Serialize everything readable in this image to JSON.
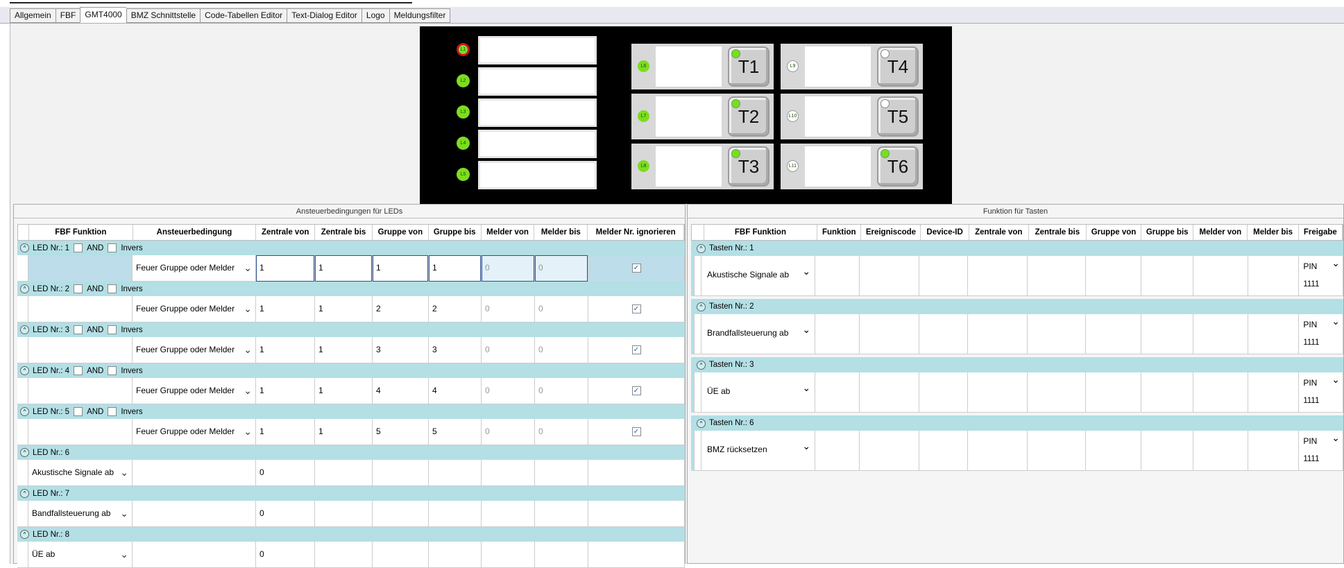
{
  "tabs": [
    "Allgemein",
    "FBF",
    "GMT4000",
    "BMZ Schnittstelle",
    "Code-Tabellen Editor",
    "Text-Dialog Editor",
    "Logo",
    "Meldungsfilter"
  ],
  "active_tab": "GMT4000",
  "panel": {
    "leds_left": [
      "L1",
      "L2",
      "L3",
      "L4",
      "L5"
    ],
    "led_mid": [
      "L6",
      "L7",
      "L8"
    ],
    "led_right": [
      "L9",
      "L10",
      "L11"
    ],
    "keys_mid": [
      "T1",
      "T2",
      "T3"
    ],
    "keys_right": [
      "T4",
      "T5",
      "T6"
    ]
  },
  "left": {
    "title": "Ansteuerbedingungen für LEDs",
    "headers": [
      "FBF Funktion",
      "Ansteuerbedingung",
      "Zentrale von",
      "Zentrale bis",
      "Gruppe von",
      "Gruppe bis",
      "Melder von",
      "Melder bis",
      "Melder Nr. ignorieren"
    ],
    "and_label": "AND",
    "invers_label": "Invers",
    "groups": [
      {
        "label": "LED Nr.: 1",
        "fbf": "",
        "bed": "Feuer Gruppe oder Melder",
        "zv": "1",
        "zb": "1",
        "gv": "1",
        "gb": "1",
        "mv": "0",
        "mb": "0"
      },
      {
        "label": "LED Nr.: 2",
        "fbf": "",
        "bed": "Feuer Gruppe oder Melder",
        "zv": "1",
        "zb": "1",
        "gv": "2",
        "gb": "2",
        "mv": "0",
        "mb": "0"
      },
      {
        "label": "LED Nr.: 3",
        "fbf": "",
        "bed": "Feuer Gruppe oder Melder",
        "zv": "1",
        "zb": "1",
        "gv": "3",
        "gb": "3",
        "mv": "0",
        "mb": "0"
      },
      {
        "label": "LED Nr.: 4",
        "fbf": "",
        "bed": "Feuer Gruppe oder Melder",
        "zv": "1",
        "zb": "1",
        "gv": "4",
        "gb": "4",
        "mv": "0",
        "mb": "0"
      },
      {
        "label": "LED Nr.: 5",
        "fbf": "",
        "bed": "Feuer Gruppe oder Melder",
        "zv": "1",
        "zb": "1",
        "gv": "5",
        "gb": "5",
        "mv": "0",
        "mb": "0"
      },
      {
        "label": "LED Nr.: 6",
        "fbf": "Akustische Signale ab",
        "bed": "",
        "zv": "0"
      },
      {
        "label": "LED Nr.: 7",
        "fbf": "Bandfallsteuerung ab",
        "bed": "",
        "zv": "0"
      },
      {
        "label": "LED Nr.: 8",
        "fbf": "ÜE ab",
        "bed": "",
        "zv": "0"
      }
    ]
  },
  "right": {
    "title": "Funktion für Tasten",
    "headers": [
      "FBF Funktion",
      "Funktion",
      "Ereigniscode",
      "Device-ID",
      "Zentrale von",
      "Zentrale bis",
      "Gruppe von",
      "Gruppe bis",
      "Melder von",
      "Melder bis",
      "Freigabe"
    ],
    "groups": [
      {
        "label": "Tasten Nr.: 1",
        "fbf": "Akustische Signale ab",
        "freigabe": "PIN",
        "pin": "1111"
      },
      {
        "label": "Tasten Nr.: 2",
        "fbf": "Brandfallsteuerung ab",
        "freigabe": "PIN",
        "pin": "1111"
      },
      {
        "label": "Tasten Nr.: 3",
        "fbf": "ÜE ab",
        "freigabe": "PIN",
        "pin": "1111"
      },
      {
        "label": "Tasten Nr.: 6",
        "fbf": "BMZ rücksetzen",
        "freigabe": "PIN",
        "pin": "1111"
      }
    ]
  }
}
